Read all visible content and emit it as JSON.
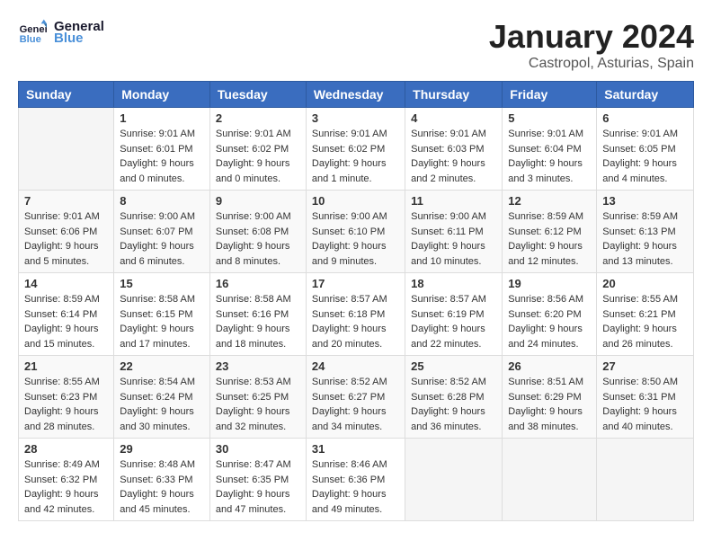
{
  "header": {
    "logo_line1": "General",
    "logo_line2": "Blue",
    "month_title": "January 2024",
    "location": "Castropol, Asturias, Spain"
  },
  "weekdays": [
    "Sunday",
    "Monday",
    "Tuesday",
    "Wednesday",
    "Thursday",
    "Friday",
    "Saturday"
  ],
  "weeks": [
    [
      {
        "day": "",
        "info": ""
      },
      {
        "day": "1",
        "info": "Sunrise: 9:01 AM\nSunset: 6:01 PM\nDaylight: 9 hours\nand 0 minutes."
      },
      {
        "day": "2",
        "info": "Sunrise: 9:01 AM\nSunset: 6:02 PM\nDaylight: 9 hours\nand 0 minutes."
      },
      {
        "day": "3",
        "info": "Sunrise: 9:01 AM\nSunset: 6:02 PM\nDaylight: 9 hours\nand 1 minute."
      },
      {
        "day": "4",
        "info": "Sunrise: 9:01 AM\nSunset: 6:03 PM\nDaylight: 9 hours\nand 2 minutes."
      },
      {
        "day": "5",
        "info": "Sunrise: 9:01 AM\nSunset: 6:04 PM\nDaylight: 9 hours\nand 3 minutes."
      },
      {
        "day": "6",
        "info": "Sunrise: 9:01 AM\nSunset: 6:05 PM\nDaylight: 9 hours\nand 4 minutes."
      }
    ],
    [
      {
        "day": "7",
        "info": "Sunrise: 9:01 AM\nSunset: 6:06 PM\nDaylight: 9 hours\nand 5 minutes."
      },
      {
        "day": "8",
        "info": "Sunrise: 9:00 AM\nSunset: 6:07 PM\nDaylight: 9 hours\nand 6 minutes."
      },
      {
        "day": "9",
        "info": "Sunrise: 9:00 AM\nSunset: 6:08 PM\nDaylight: 9 hours\nand 8 minutes."
      },
      {
        "day": "10",
        "info": "Sunrise: 9:00 AM\nSunset: 6:10 PM\nDaylight: 9 hours\nand 9 minutes."
      },
      {
        "day": "11",
        "info": "Sunrise: 9:00 AM\nSunset: 6:11 PM\nDaylight: 9 hours\nand 10 minutes."
      },
      {
        "day": "12",
        "info": "Sunrise: 8:59 AM\nSunset: 6:12 PM\nDaylight: 9 hours\nand 12 minutes."
      },
      {
        "day": "13",
        "info": "Sunrise: 8:59 AM\nSunset: 6:13 PM\nDaylight: 9 hours\nand 13 minutes."
      }
    ],
    [
      {
        "day": "14",
        "info": "Sunrise: 8:59 AM\nSunset: 6:14 PM\nDaylight: 9 hours\nand 15 minutes."
      },
      {
        "day": "15",
        "info": "Sunrise: 8:58 AM\nSunset: 6:15 PM\nDaylight: 9 hours\nand 17 minutes."
      },
      {
        "day": "16",
        "info": "Sunrise: 8:58 AM\nSunset: 6:16 PM\nDaylight: 9 hours\nand 18 minutes."
      },
      {
        "day": "17",
        "info": "Sunrise: 8:57 AM\nSunset: 6:18 PM\nDaylight: 9 hours\nand 20 minutes."
      },
      {
        "day": "18",
        "info": "Sunrise: 8:57 AM\nSunset: 6:19 PM\nDaylight: 9 hours\nand 22 minutes."
      },
      {
        "day": "19",
        "info": "Sunrise: 8:56 AM\nSunset: 6:20 PM\nDaylight: 9 hours\nand 24 minutes."
      },
      {
        "day": "20",
        "info": "Sunrise: 8:55 AM\nSunset: 6:21 PM\nDaylight: 9 hours\nand 26 minutes."
      }
    ],
    [
      {
        "day": "21",
        "info": "Sunrise: 8:55 AM\nSunset: 6:23 PM\nDaylight: 9 hours\nand 28 minutes."
      },
      {
        "day": "22",
        "info": "Sunrise: 8:54 AM\nSunset: 6:24 PM\nDaylight: 9 hours\nand 30 minutes."
      },
      {
        "day": "23",
        "info": "Sunrise: 8:53 AM\nSunset: 6:25 PM\nDaylight: 9 hours\nand 32 minutes."
      },
      {
        "day": "24",
        "info": "Sunrise: 8:52 AM\nSunset: 6:27 PM\nDaylight: 9 hours\nand 34 minutes."
      },
      {
        "day": "25",
        "info": "Sunrise: 8:52 AM\nSunset: 6:28 PM\nDaylight: 9 hours\nand 36 minutes."
      },
      {
        "day": "26",
        "info": "Sunrise: 8:51 AM\nSunset: 6:29 PM\nDaylight: 9 hours\nand 38 minutes."
      },
      {
        "day": "27",
        "info": "Sunrise: 8:50 AM\nSunset: 6:31 PM\nDaylight: 9 hours\nand 40 minutes."
      }
    ],
    [
      {
        "day": "28",
        "info": "Sunrise: 8:49 AM\nSunset: 6:32 PM\nDaylight: 9 hours\nand 42 minutes."
      },
      {
        "day": "29",
        "info": "Sunrise: 8:48 AM\nSunset: 6:33 PM\nDaylight: 9 hours\nand 45 minutes."
      },
      {
        "day": "30",
        "info": "Sunrise: 8:47 AM\nSunset: 6:35 PM\nDaylight: 9 hours\nand 47 minutes."
      },
      {
        "day": "31",
        "info": "Sunrise: 8:46 AM\nSunset: 6:36 PM\nDaylight: 9 hours\nand 49 minutes."
      },
      {
        "day": "",
        "info": ""
      },
      {
        "day": "",
        "info": ""
      },
      {
        "day": "",
        "info": ""
      }
    ]
  ]
}
